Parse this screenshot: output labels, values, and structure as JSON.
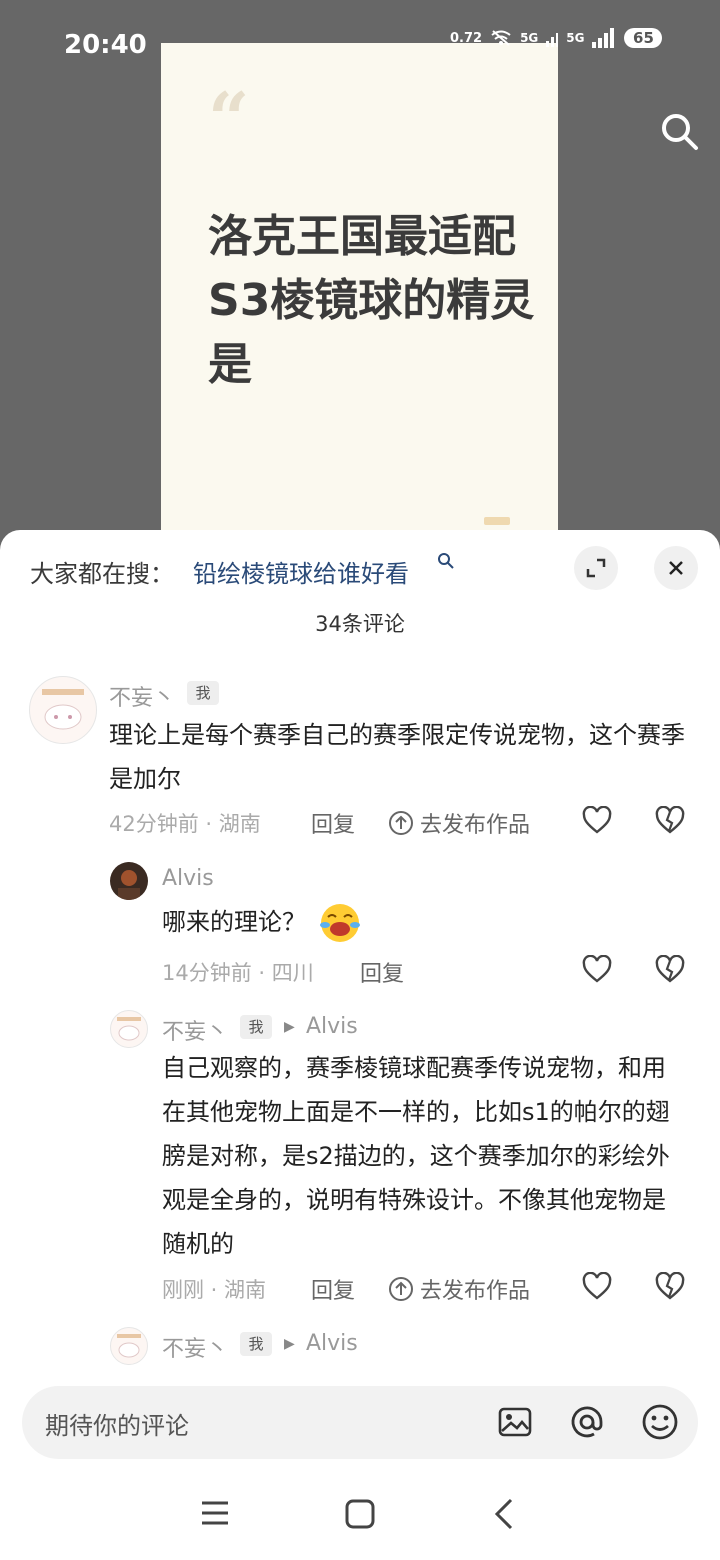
{
  "status_bar": {
    "time": "20:40",
    "speed": "0.72",
    "net1": "5G",
    "net2": "5G",
    "battery": "65"
  },
  "card": {
    "title": "洛克王国最适配S3棱镜球的精灵是"
  },
  "sheet": {
    "hot_search_label": "大家都在搜：",
    "hot_search_link": "铅绘棱镜球给谁好看",
    "comment_count": "34条评论"
  },
  "comments": [
    {
      "user": "不妄丶",
      "badge": "我",
      "text": "理论上是每个赛季自己的赛季限定传说宠物，这个赛季是加尔",
      "meta": "42分钟前 · 湖南",
      "reply": "回复",
      "publish": "去发布作品"
    },
    {
      "user": "Alvis",
      "text": "哪来的理论？",
      "meta": "14分钟前 · 四川",
      "reply": "回复"
    },
    {
      "user": "不妄丶",
      "badge": "我",
      "reply_to": "Alvis",
      "text": "自己观察的，赛季棱镜球配赛季传说宠物，和用在其他宠物上面是不一样的，比如s1的帕尔的翅膀是对称，是s2描边的，这个赛季加尔的彩绘外观是全身的，说明有特殊设计。不像其他宠物是随机的",
      "meta": "刚刚 · 湖南",
      "reply": "回复",
      "publish": "去发布作品"
    },
    {
      "user": "不妄丶",
      "badge": "我",
      "reply_to": "Alvis"
    }
  ],
  "input": {
    "placeholder": "期待你的评论"
  }
}
